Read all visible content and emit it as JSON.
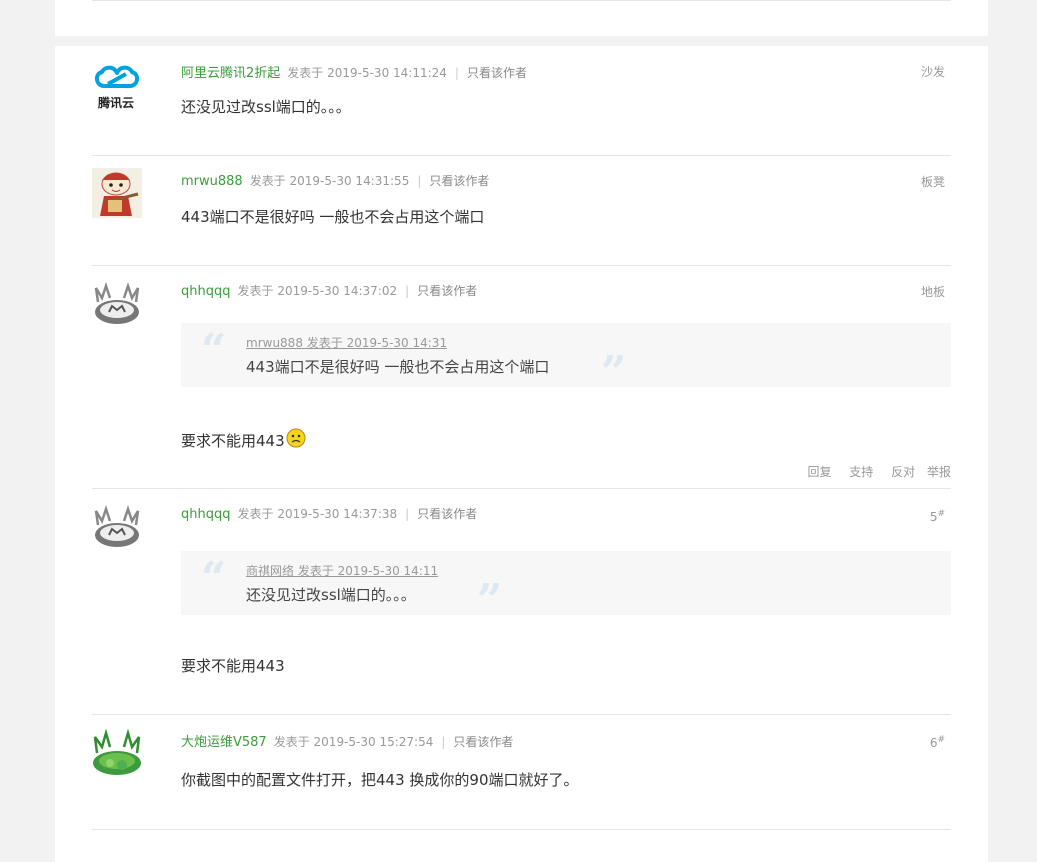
{
  "posts": [
    {
      "author": "阿里云腾讯2折起",
      "posted": "发表于 2019-5-30 14:11:24",
      "view_only": "只看该作者",
      "floor": "沙发",
      "content": "还没见过改ssl端口的。。。",
      "avatar_text": "腾讯云"
    },
    {
      "author": "mrwu888",
      "posted": "发表于 2019-5-30 14:31:55",
      "view_only": "只看该作者",
      "floor": "板凳",
      "content": "443端口不是很好吗 一般也不会占用这个端口"
    },
    {
      "author": "qhhqqq",
      "posted": "发表于 2019-5-30 14:37:02",
      "view_only": "只看该作者",
      "floor": "地板",
      "quote_head": "mrwu888 发表于 2019-5-30 14:31",
      "quote_body": "443端口不是很好吗 一般也不会占用这个端口",
      "content": "要求不能用443",
      "actions": {
        "reply": "回复",
        "support": "支持",
        "oppose": "反对",
        "report": "举报"
      }
    },
    {
      "author": "qhhqqq",
      "posted": "发表于 2019-5-30 14:37:38",
      "view_only": "只看该作者",
      "floor_num": "5",
      "floor_mark": "#",
      "quote_head": "商祺网络 发表于 2019-5-30 14:11",
      "quote_body": "还没见过改ssl端口的。。。",
      "content": "要求不能用443"
    },
    {
      "author": "大炮运维V587",
      "posted": "发表于 2019-5-30 15:27:54",
      "view_only": "只看该作者",
      "floor_num": "6",
      "floor_mark": "#",
      "content": "你截图中的配置文件打开，把443 换成你的90端口就好了。"
    }
  ],
  "colors": {
    "author": "#3a9e3a",
    "meta": "#999999",
    "divider": "#e5e5e5",
    "quote_bg": "#f7f7f7"
  }
}
